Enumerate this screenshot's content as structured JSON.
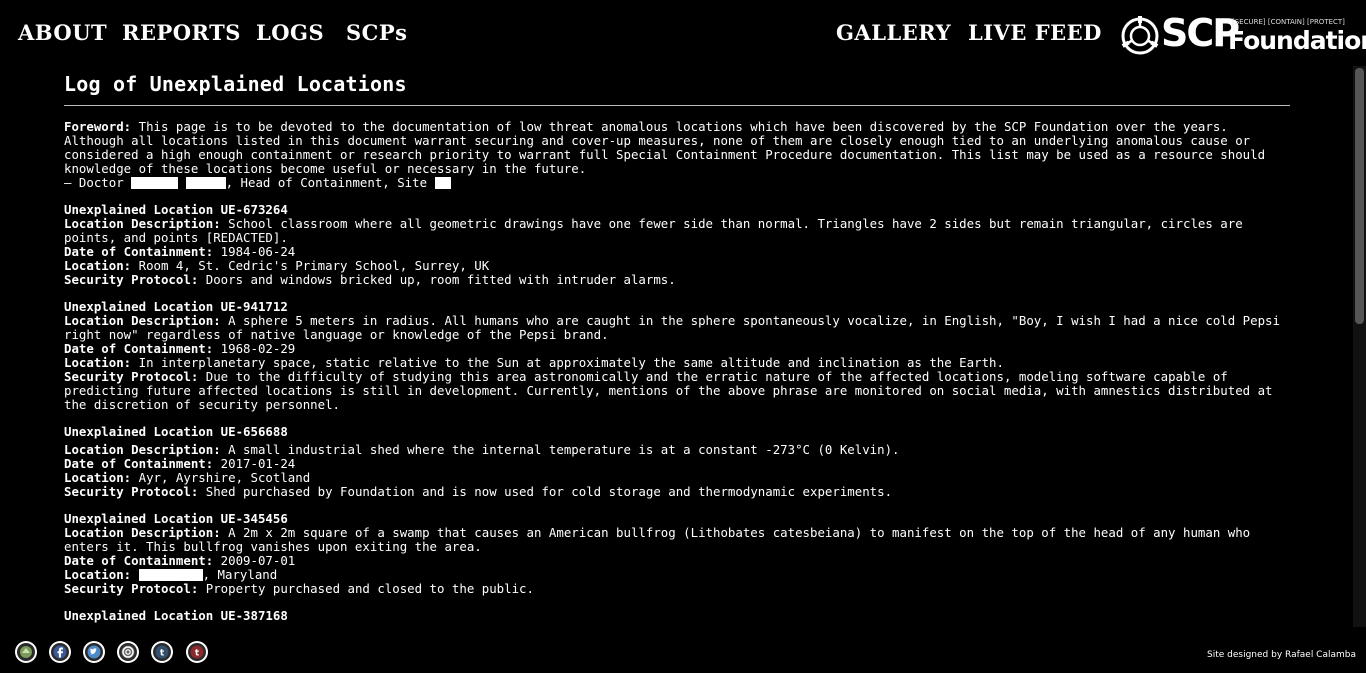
{
  "nav": {
    "about": "ABOUT",
    "reports": "REPORTS",
    "logs": "LOGS",
    "scps": "SCPs",
    "gallery": "GALLERY",
    "live_feed": "LIVE FEED"
  },
  "logo": {
    "scp": "SCP",
    "tagline": "[SECURE] [CONTAIN] [PROTECT]",
    "foundation": "Foundation"
  },
  "page": {
    "title": "Log of Unexplained Locations"
  },
  "foreword": {
    "label": "Foreword:",
    "text": "This page is to be devoted to the documentation of low threat anomalous locations which have been discovered by the SCP Foundation over the years. Although all locations listed in this document warrant securing and cover-up measures, none of them are closely enough tied to an underlying anomalous cause or considered a high enough containment or research priority to warrant full Special Containment Procedure documentation. This list may be used as a resource should knowledge of these locations become useful or necessary in the future.",
    "sig_prefix": "– Doctor",
    "sig_suffix": ", Head of Containment, Site"
  },
  "labels": {
    "description": "Location Description:",
    "date": "Date of Containment:",
    "location": "Location:",
    "protocol": "Security Protocol:"
  },
  "entries": [
    {
      "title": "Unexplained Location UE-673264",
      "description": "School classroom where all geometric drawings have one fewer side than normal. Triangles have 2 sides but remain triangular, circles are points, and points [REDACTED].",
      "date": "1984-06-24",
      "location": "Room 4, St. Cedric's Primary School, Surrey, UK",
      "protocol": "Doors and windows bricked up, room fitted with intruder alarms."
    },
    {
      "title": "Unexplained Location UE-941712",
      "description": "A sphere 5 meters in radius. All humans who are caught in the sphere spontaneously vocalize, in English, \"Boy, I wish I had a nice cold Pepsi right now\" regardless of native language or knowledge of the Pepsi brand.",
      "date": "1968-02-29",
      "location": "In interplanetary space, static relative to the Sun at approximately the same altitude and inclination as the Earth.",
      "protocol": "Due to the difficulty of studying this area astronomically and the erratic nature of the affected locations, modeling software capable of predicting future affected locations is still in development. Currently, mentions of the above phrase are monitored on social media, with amnestics distributed at the discretion of security personnel."
    },
    {
      "title": "Unexplained Location UE-656688",
      "description": "A small industrial shed where the internal temperature is at a constant -273°C (0 Kelvin).",
      "date": "2017-01-24",
      "location": "Ayr, Ayrshire, Scotland",
      "protocol": "Shed purchased by Foundation and is now used for cold storage and thermodynamic experiments."
    },
    {
      "title": "Unexplained Location UE-345456",
      "description": "A 2m x 2m square of a swamp that causes an American bullfrog (Lithobates catesbeiana) to manifest on the top of the head of any human who enters it. This bullfrog vanishes upon exiting the area.",
      "date": "2009-07-01",
      "location_suffix": ", Maryland",
      "protocol": "Property purchased and closed to the public."
    },
    {
      "title": "Unexplained Location UE-387168"
    }
  ],
  "footer": {
    "credit": "Site designed by Rafael Calamba",
    "social_icons": [
      "scp-wiki-icon",
      "facebook-icon",
      "twitter-icon",
      "scp-seal-icon",
      "tumblr-icon",
      "tumblr-alt-icon"
    ]
  },
  "colors": {
    "background": "#000000",
    "text": "#ffffff",
    "redaction": "#ffffff",
    "rule": "#bbbbbb"
  }
}
